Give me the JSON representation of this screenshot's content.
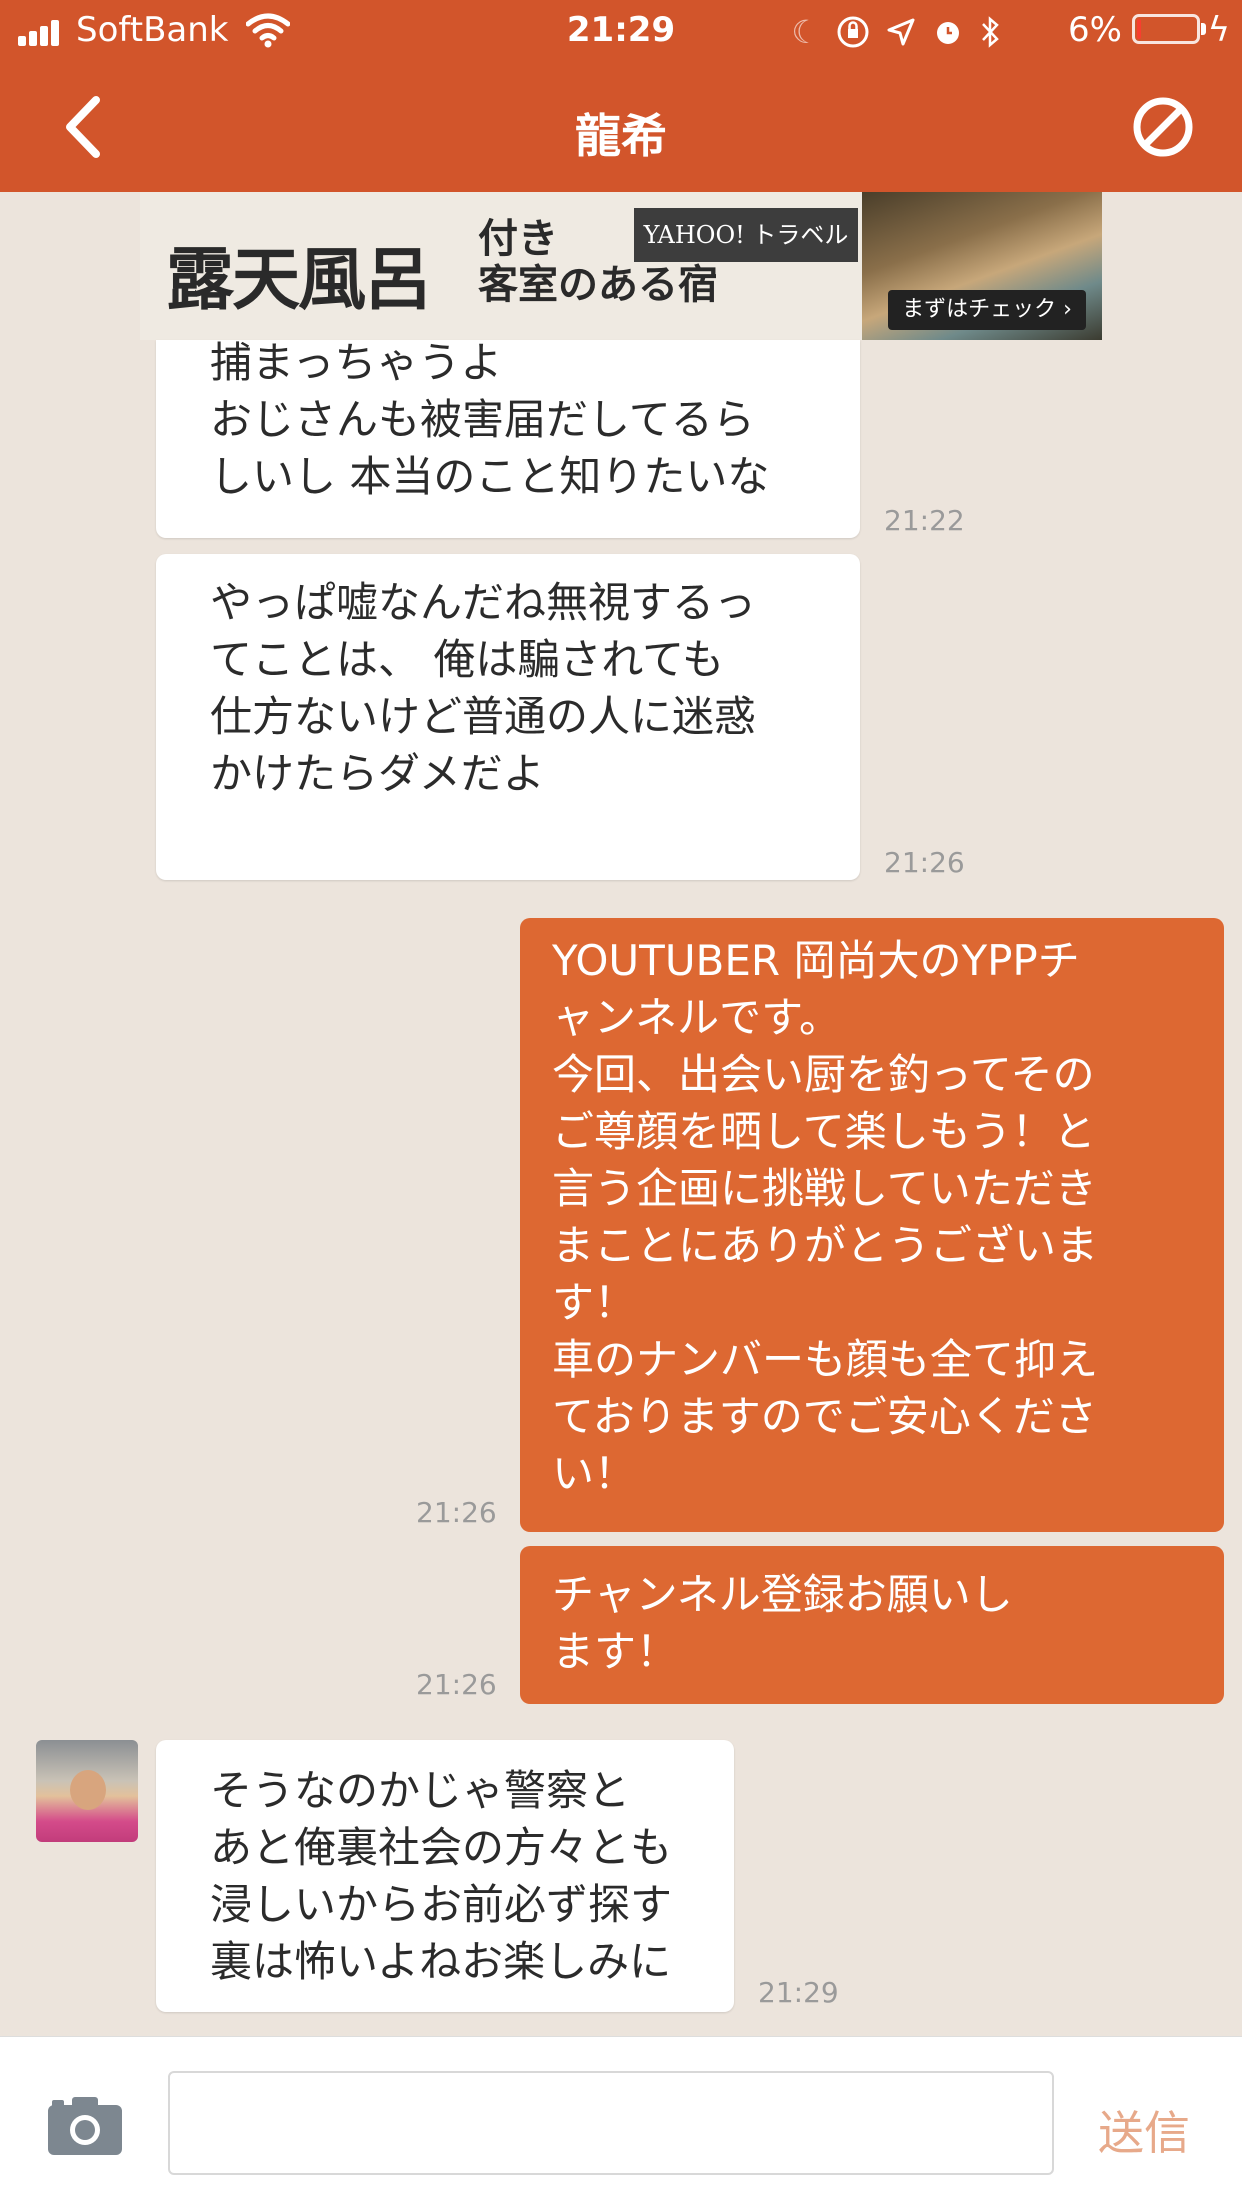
{
  "status_bar": {
    "carrier": "SoftBank",
    "time": "21:29",
    "battery_percent": "6%",
    "battery_level": 0.06,
    "battery_color": "#ff3b30"
  },
  "nav": {
    "title": "龍希",
    "back_icon": "chevron-left-icon",
    "block_icon": "block-icon"
  },
  "ad": {
    "main_text": "露天風呂",
    "sub_line1": "付き",
    "sub_line2": "客室のある宿",
    "logo_text": "YAHOO! トラベル",
    "cta": "まずはチェック ›"
  },
  "messages": [
    {
      "direction": "incoming",
      "lines": [
        "捕まっちゃうよ",
        "おじさんも被害届だしてるら",
        "しいし  本当のこと知りたいな"
      ],
      "time": "21:22"
    },
    {
      "direction": "incoming",
      "lines": [
        "やっぱ嘘なんだね無視するっ",
        "てことは、  俺は騙されても",
        "仕方ないけど普通の人に迷惑",
        "かけたらダメだよ"
      ],
      "time": "21:26"
    },
    {
      "direction": "outgoing",
      "lines": [
        "YOUTUBER 岡尚大のYPPチ",
        "ャンネルです。",
        "今回、出会い厨を釣ってその",
        "ご尊顔を晒して楽しもう！と",
        "言う企画に挑戦していただき",
        "まことにありがとうございま",
        "す！",
        "車のナンバーも顔も全て抑え",
        "ておりますのでご安心くださ",
        "い！"
      ],
      "time": "21:26"
    },
    {
      "direction": "outgoing",
      "lines": [
        "チャンネル登録お願いし",
        "ます！"
      ],
      "time": "21:26"
    },
    {
      "direction": "incoming",
      "lines": [
        "そうなのかじゃ警察と",
        "あと俺裏社会の方々とも",
        "浸しいからお前必ず探す",
        "裏は怖いよねお楽しみに"
      ],
      "time": "21:29"
    }
  ],
  "input": {
    "placeholder": "",
    "send_label": "送信",
    "camera_icon": "camera-icon"
  },
  "colors": {
    "header": "#d2552b",
    "outgoing_bubble": "#dd6832",
    "background": "#ece4dc",
    "send_disabled": "#e7a98a"
  }
}
